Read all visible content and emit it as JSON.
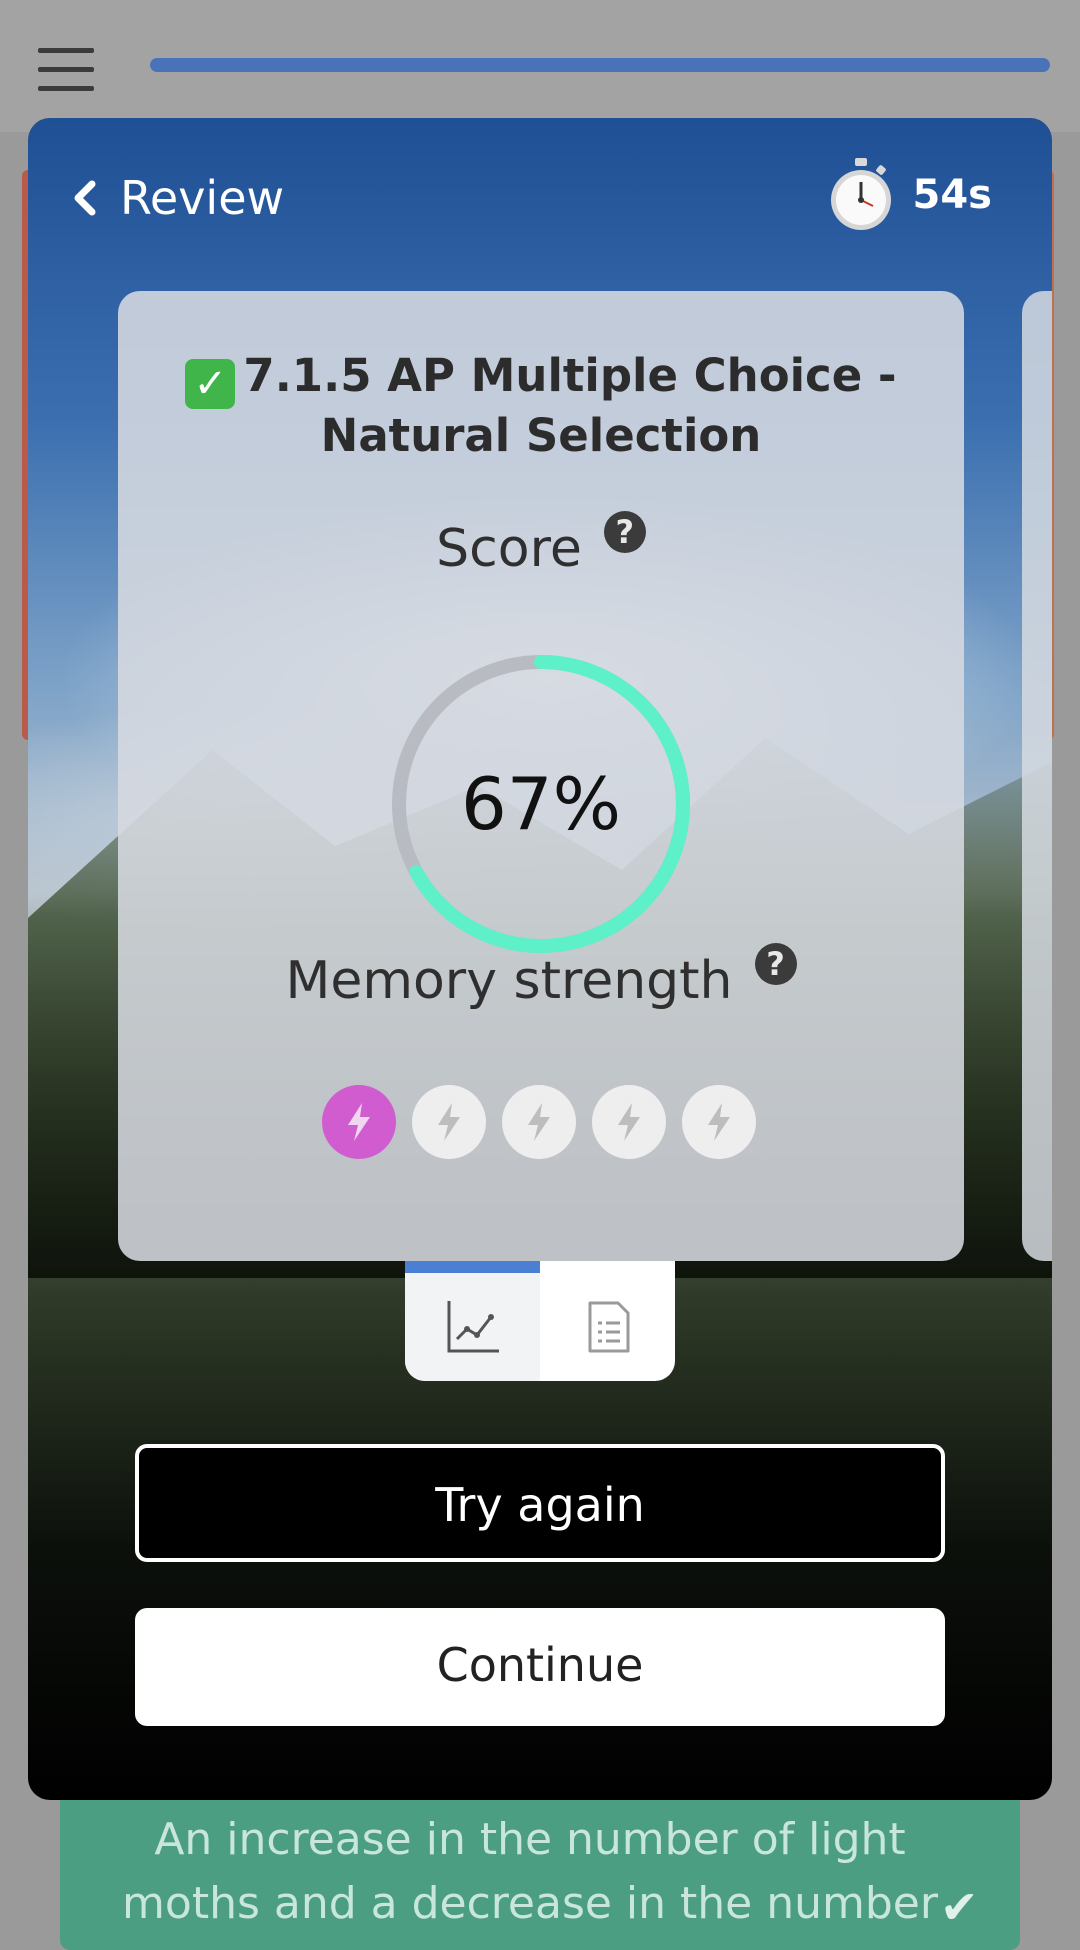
{
  "topbar": {
    "menu_icon": "hamburger-icon",
    "progress_fraction": 1.0,
    "progress_color": "#4a72b8"
  },
  "background": {
    "answer_text": "An increase in the number of light moths and a decrease in the number",
    "answer_color": "#4b9e82"
  },
  "modal": {
    "back_label": "Review",
    "timer_value": "54s",
    "timer_icon": "stopwatch-icon"
  },
  "panel": {
    "title": "7.1.5 AP Multiple Choice - Natural Selection",
    "title_icon": "check-mark-icon",
    "score_label": "Score",
    "score_value": "67%",
    "score_fraction": 0.67,
    "score_color": "#5ef0c8",
    "memory_label": "Memory strength",
    "memory_level": 1,
    "memory_max": 5,
    "memory_on_color": "#d05ccf"
  },
  "tabs": [
    {
      "name": "chart-tab",
      "icon": "line-chart-icon",
      "active": true
    },
    {
      "name": "list-tab",
      "icon": "document-list-icon",
      "active": false
    }
  ],
  "actions": {
    "try_again_label": "Try again",
    "continue_label": "Continue"
  }
}
